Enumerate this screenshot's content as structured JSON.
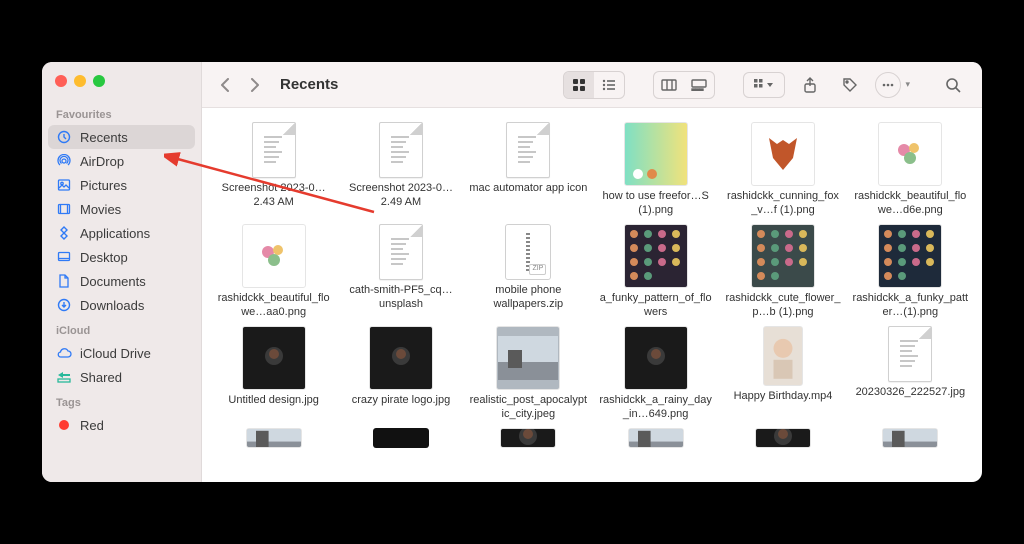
{
  "window": {
    "title": "Recents"
  },
  "sidebar": {
    "sections": [
      {
        "label": "Favourites",
        "items": [
          {
            "icon": "clock",
            "label": "Recents",
            "active": true
          },
          {
            "icon": "airdrop",
            "label": "AirDrop"
          },
          {
            "icon": "pictures",
            "label": "Pictures"
          },
          {
            "icon": "movies",
            "label": "Movies"
          },
          {
            "icon": "apps",
            "label": "Applications"
          },
          {
            "icon": "desktop",
            "label": "Desktop"
          },
          {
            "icon": "doc",
            "label": "Documents"
          },
          {
            "icon": "download",
            "label": "Downloads"
          }
        ]
      },
      {
        "label": "iCloud",
        "items": [
          {
            "icon": "cloud",
            "label": "iCloud Drive"
          },
          {
            "icon": "shared",
            "label": "Shared"
          }
        ]
      },
      {
        "label": "Tags",
        "items": [
          {
            "icon": "tag-red",
            "label": "Red"
          }
        ]
      }
    ]
  },
  "files": [
    {
      "name": "Screenshot 2023-0…2.43 AM",
      "thumb": "doc"
    },
    {
      "name": "Screenshot 2023-0…2.49 AM",
      "thumb": "doc"
    },
    {
      "name": "mac automator app icon",
      "thumb": "doc"
    },
    {
      "name": "how to use freefor…S (1).png",
      "thumb": "gradient"
    },
    {
      "name": "rashidckk_cunning_fox_v…f (1).png",
      "thumb": "fox"
    },
    {
      "name": "rashidckk_beautiful_flowe…d6e.png",
      "thumb": "flower-white"
    },
    {
      "name": "rashidckk_beautiful_flowe…aa0.png",
      "thumb": "flower-white"
    },
    {
      "name": "cath-smith-PF5_cq…unsplash",
      "thumb": "doc"
    },
    {
      "name": "mobile phone wallpapers.zip",
      "thumb": "zip"
    },
    {
      "name": "a_funky_pattern_of_flowers",
      "thumb": "pattern-dark"
    },
    {
      "name": "rashidckk_cute_flower_p…b (1).png",
      "thumb": "pattern-mid"
    },
    {
      "name": "rashidckk_a_funky_patter…(1).png",
      "thumb": "pattern-navy"
    },
    {
      "name": "Untitled design.jpg",
      "thumb": "dark-img"
    },
    {
      "name": "crazy pirate logo.jpg",
      "thumb": "dark-img"
    },
    {
      "name": "realistic_post_apocalyptic_city.jpeg",
      "thumb": "photo"
    },
    {
      "name": "rashidckk_a_rainy_day_in…649.png",
      "thumb": "dark-img"
    },
    {
      "name": "Happy Birthday.mp4",
      "thumb": "baby"
    },
    {
      "name": "20230326_222527.jpg",
      "thumb": "doc"
    }
  ],
  "partial_row": [
    {
      "thumb": "photo"
    },
    {
      "thumb": "strip"
    },
    {
      "thumb": "dark-img"
    },
    {
      "thumb": "photo"
    },
    {
      "thumb": "dark-img"
    },
    {
      "thumb": "photo"
    }
  ],
  "zip_badge": "ZIP"
}
